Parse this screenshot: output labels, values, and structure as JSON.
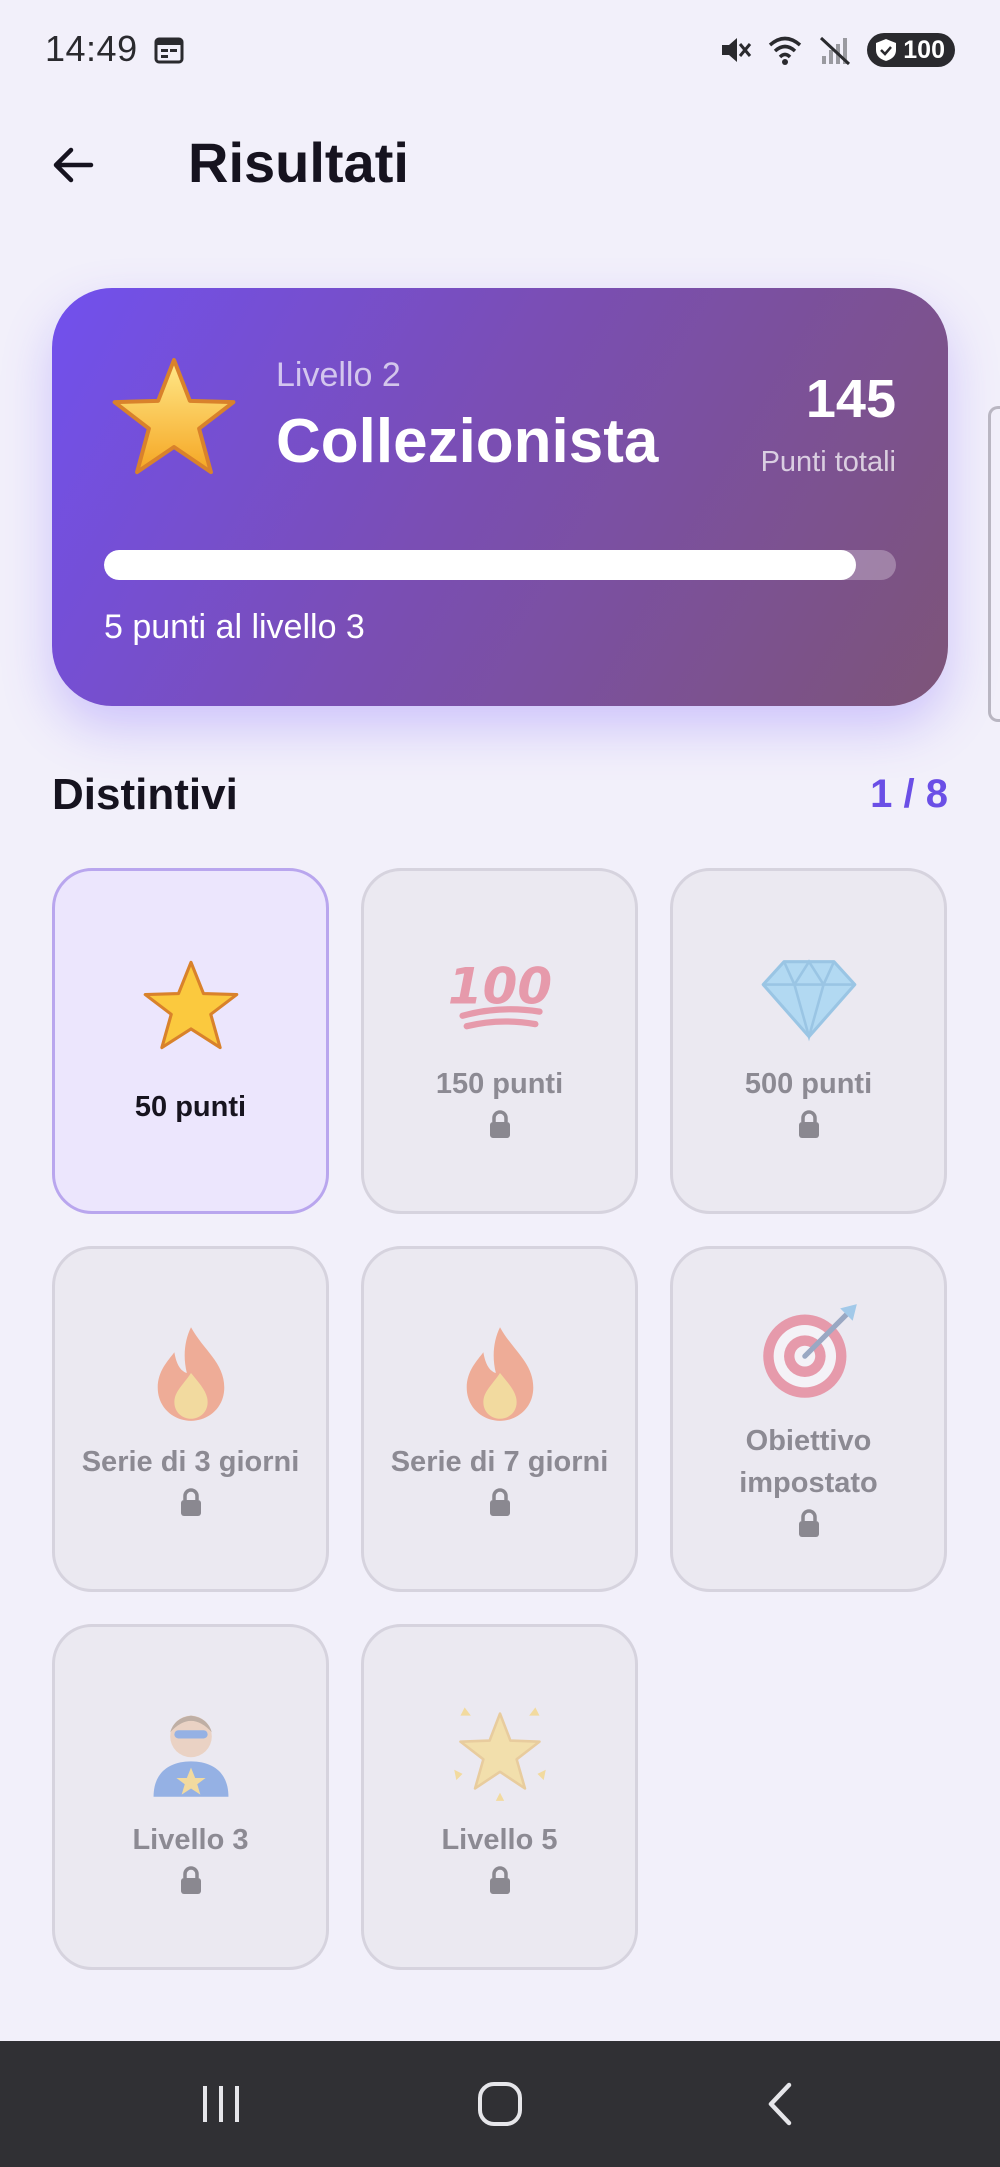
{
  "status_bar": {
    "time": "14:49",
    "battery": "100"
  },
  "header": {
    "title": "Risultati"
  },
  "level_card": {
    "level_label": "Livello 2",
    "level_name": "Collezionista",
    "points": "145",
    "points_label": "Punti totali",
    "progress_fraction": 0.95,
    "progress_text": "5 punti al livello 3"
  },
  "badges_section": {
    "title": "Distintivi",
    "count": "1 / 8",
    "items": [
      {
        "label": "50 punti",
        "icon": "star-icon",
        "locked": false
      },
      {
        "label": "150 punti",
        "icon": "hundred-points-icon",
        "locked": true
      },
      {
        "label": "500 punti",
        "icon": "gem-icon",
        "locked": true
      },
      {
        "label": "Serie di 3 giorni",
        "icon": "fire-icon",
        "locked": true
      },
      {
        "label": "Serie di 7 giorni",
        "icon": "fire-icon",
        "locked": true
      },
      {
        "label": "Obiettivo impostato",
        "icon": "target-icon",
        "locked": true
      },
      {
        "label": "Livello 3",
        "icon": "superhero-icon",
        "locked": true
      },
      {
        "label": "Livello 5",
        "icon": "glowing-star-icon",
        "locked": true
      }
    ]
  },
  "colors": {
    "accent": "#6b4fe6",
    "card_gradient_start": "#7150ee",
    "card_gradient_end": "#7d5478",
    "background": "#f2f0fa"
  }
}
